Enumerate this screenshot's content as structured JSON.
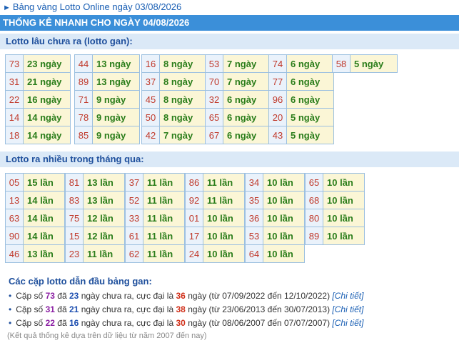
{
  "top_link": "Bảng vàng Lotto Online ngày 03/08/2026",
  "header": "THỐNG KÊ NHANH CHO NGÀY 04/08/2026",
  "gan": {
    "title": "Lotto lâu chưa ra (lotto gan):",
    "groups": [
      [
        [
          "73",
          "23 ngày"
        ],
        [
          "31",
          "21 ngày"
        ],
        [
          "22",
          "16 ngày"
        ],
        [
          "14",
          "14 ngày"
        ],
        [
          "18",
          "14 ngày"
        ]
      ],
      [
        [
          "44",
          "13 ngày"
        ],
        [
          "89",
          "13 ngày"
        ],
        [
          "71",
          "9 ngày"
        ],
        [
          "78",
          "9 ngày"
        ],
        [
          "85",
          "9 ngày"
        ]
      ],
      [
        [
          "16",
          "8 ngày"
        ],
        [
          "37",
          "8 ngày"
        ],
        [
          "45",
          "8 ngày"
        ],
        [
          "50",
          "8 ngày"
        ],
        [
          "42",
          "7 ngày"
        ]
      ],
      [
        [
          "53",
          "7 ngày"
        ],
        [
          "70",
          "7 ngày"
        ],
        [
          "32",
          "6 ngày"
        ],
        [
          "65",
          "6 ngày"
        ],
        [
          "67",
          "6 ngày"
        ]
      ],
      [
        [
          "74",
          "6 ngày"
        ],
        [
          "77",
          "6 ngày"
        ],
        [
          "96",
          "6 ngày"
        ],
        [
          "20",
          "5 ngày"
        ],
        [
          "43",
          "5 ngày"
        ]
      ],
      [
        [
          "58",
          "5 ngày"
        ]
      ]
    ]
  },
  "frequent": {
    "title": "Lotto ra nhiều trong tháng qua:",
    "groups": [
      [
        [
          "05",
          "15 lần"
        ],
        [
          "13",
          "14 lần"
        ],
        [
          "63",
          "14 lần"
        ],
        [
          "90",
          "14 lần"
        ],
        [
          "46",
          "13 lần"
        ]
      ],
      [
        [
          "81",
          "13 lần"
        ],
        [
          "83",
          "13 lần"
        ],
        [
          "75",
          "12 lần"
        ],
        [
          "15",
          "12 lần"
        ],
        [
          "23",
          "11 lần"
        ]
      ],
      [
        [
          "37",
          "11 lần"
        ],
        [
          "52",
          "11 lần"
        ],
        [
          "33",
          "11 lần"
        ],
        [
          "61",
          "11 lần"
        ],
        [
          "62",
          "11 lần"
        ]
      ],
      [
        [
          "86",
          "11 lần"
        ],
        [
          "92",
          "11 lần"
        ],
        [
          "01",
          "10 lần"
        ],
        [
          "17",
          "10 lần"
        ],
        [
          "24",
          "10 lần"
        ]
      ],
      [
        [
          "34",
          "10 lần"
        ],
        [
          "35",
          "10 lần"
        ],
        [
          "36",
          "10 lần"
        ],
        [
          "53",
          "10 lần"
        ],
        [
          "64",
          "10 lần"
        ]
      ],
      [
        [
          "65",
          "10 lần"
        ],
        [
          "68",
          "10 lần"
        ],
        [
          "80",
          "10 lần"
        ],
        [
          "89",
          "10 lần"
        ]
      ]
    ]
  },
  "pairs": {
    "title": "Các cặp lotto dẫn đầu bảng gan:",
    "items": [
      {
        "prefix": "Cặp số",
        "num": "73",
        "mid1": "đã",
        "days": "23",
        "mid2": "ngày chưa ra, cực đại là",
        "max": "36",
        "range": "ngày (từ 07/09/2022 đến 12/10/2022)",
        "link": "[Chi tiết]"
      },
      {
        "prefix": "Cặp số",
        "num": "31",
        "mid1": "đã",
        "days": "21",
        "mid2": "ngày chưa ra, cực đại là",
        "max": "38",
        "range": "ngày (từ 23/06/2013 đến 30/07/2013)",
        "link": "[Chi tiết]"
      },
      {
        "prefix": "Cặp số",
        "num": "22",
        "mid1": "đã",
        "days": "16",
        "mid2": "ngày chưa ra, cực đại là",
        "max": "30",
        "range": "ngày (từ 08/06/2007 đến 07/07/2007)",
        "link": "[Chi tiết]"
      }
    ]
  },
  "footnote": "(Kết quả thống kê dựa trên dữ liệu từ năm 2007 đến nay)",
  "colors": {
    "header_bg": "#3b8fd9",
    "section_bg": "#dbe9f7",
    "number": "#c0392b",
    "value": "#2a7d1a",
    "max": "#d0301a",
    "pair_num": "#8b1fa3"
  }
}
